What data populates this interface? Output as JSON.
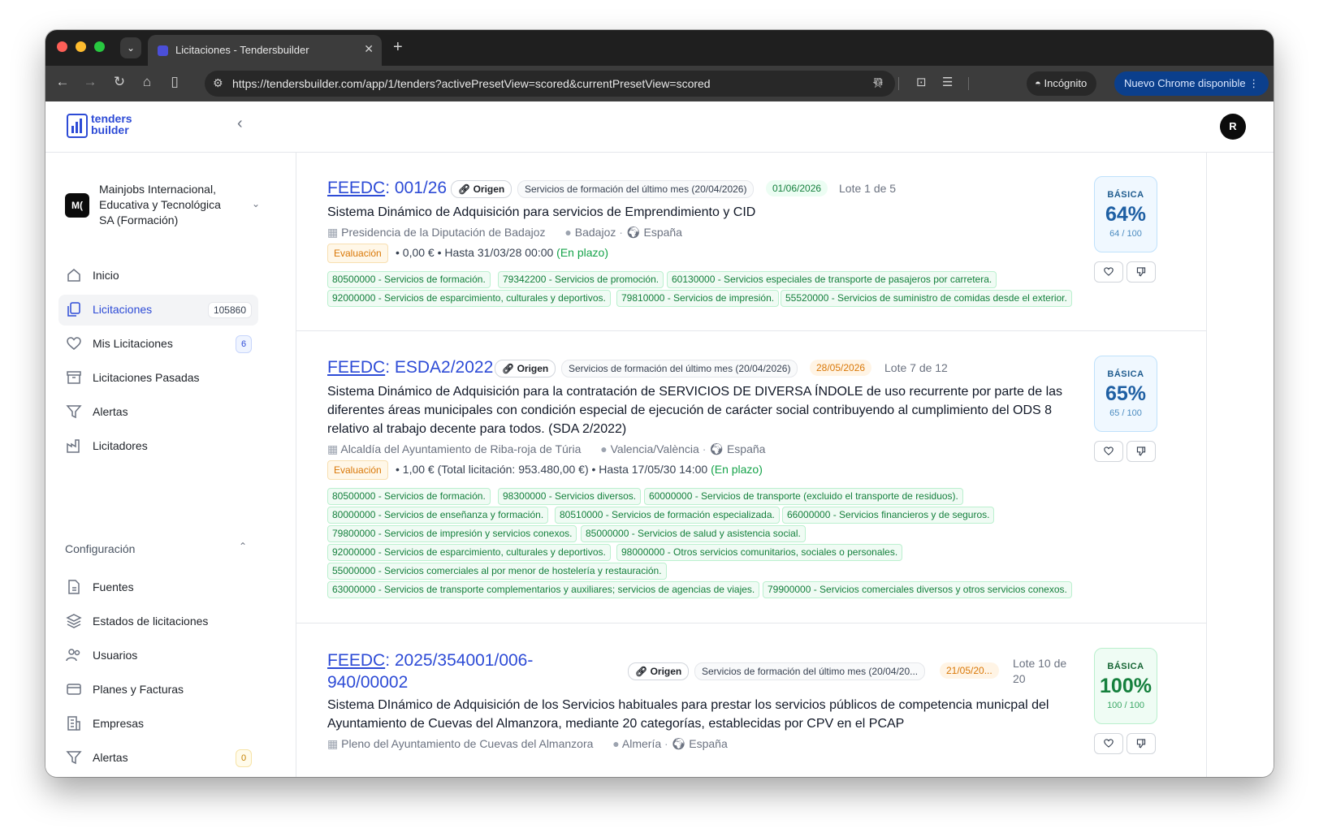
{
  "browser": {
    "tab_title": "Licitaciones - Tendersbuilder",
    "url": "https://tendersbuilder.com/app/1/tenders?activePresetView=scored&currentPresetView=scored",
    "incognito_label": "Incógnito",
    "update_label": "Nuevo Chrome disponible"
  },
  "app": {
    "logo_line1": "tenders",
    "logo_line2": "builder",
    "avatar_initial": "R"
  },
  "org": {
    "initials": "M(",
    "name": "Mainjobs Internacional, Educativa y Tecnológica SA (Formación)"
  },
  "nav": {
    "items": [
      {
        "label": "Inicio"
      },
      {
        "label": "Licitaciones",
        "count": "105860"
      },
      {
        "label": "Mis Licitaciones",
        "badge": "6"
      },
      {
        "label": "Licitaciones Pasadas"
      },
      {
        "label": "Alertas"
      },
      {
        "label": "Licitadores"
      }
    ],
    "config_title": "Configuración",
    "config_items": [
      {
        "label": "Fuentes"
      },
      {
        "label": "Estados de licitaciones"
      },
      {
        "label": "Usuarios"
      },
      {
        "label": "Planes y Facturas"
      },
      {
        "label": "Empresas"
      },
      {
        "label": "Alertas",
        "badge": "0"
      }
    ]
  },
  "tenders": [
    {
      "source": "FEEDC",
      "code": ": 001/26",
      "origin": "Origen",
      "source_chip": "Servicios de formación del último mes (20/04/2026)",
      "date": "01/06/2026",
      "lote": "Lote 1 de 5",
      "title": "Sistema Dinámico de Adquisición para servicios de Emprendimiento y CID",
      "organism": "Presidencia de la Diputación de Badajoz",
      "location": "Badajoz",
      "country": "España",
      "status": "Evaluación",
      "price": "• 0,00 € • Hasta 31/03/28 00:00",
      "deadline_state": "(En plazo)",
      "cpvs": [
        "80500000 - Servicios de formación.",
        "79342200 - Servicios de promoción.",
        "60130000 - Servicios especiales de transporte de pasajeros por carretera.",
        "92000000 - Servicios de esparcimiento, culturales y deportivos.",
        "79810000 - Servicios de impresión.",
        "55520000 - Servicios de suministro de comidas desde el exterior."
      ],
      "score_label": "BÁSICA",
      "score": "64%",
      "score_sub": "64 / 100"
    },
    {
      "source": "FEEDC",
      "code": ": ESDA2/2022",
      "origin": "Origen",
      "source_chip": "Servicios de formación del último mes (20/04/2026)",
      "date": "28/05/2026",
      "lote": "Lote 7 de 12",
      "title": "Sistema Dinámico de Adquisición para la contratación de SERVICIOS DE DIVERSA ÍNDOLE de uso recurrente por parte de las diferentes áreas municipales con condición especial de ejecución de carácter social contribuyendo al cumplimiento del ODS 8 relativo al trabajo decente para todos. (SDA 2/2022)",
      "organism": "Alcaldía del Ayuntamiento de Riba-roja de Túria",
      "location": "Valencia/València",
      "country": "España",
      "status": "Evaluación",
      "price": "• 1,00 €  (Total licitación: 953.480,00 €)  • Hasta 17/05/30 14:00",
      "deadline_state": "(En plazo)",
      "cpvs": [
        "80500000 - Servicios de formación.",
        "98300000 - Servicios diversos.",
        "60000000 - Servicios de transporte (excluido el transporte de residuos).",
        "80000000 - Servicios de enseñanza y formación.",
        "80510000 - Servicios de formación especializada.",
        "66000000 - Servicios financieros y de seguros.",
        "79800000 - Servicios de impresión y servicios conexos.",
        "85000000 - Servicios de salud y asistencia social.",
        "92000000 - Servicios de esparcimiento, culturales y deportivos.",
        "98000000 - Otros servicios comunitarios, sociales o personales.",
        "55000000 - Servicios comerciales al por menor de hostelería y restauración.",
        "63000000 - Servicios de transporte complementarios y auxiliares; servicios de agencias de viajes.",
        "79900000 - Servicios comerciales diversos y otros servicios conexos."
      ],
      "score_label": "BÁSICA",
      "score": "65%",
      "score_sub": "65 / 100"
    },
    {
      "source": "FEEDC",
      "code_line1": ": 2025/354001/006-",
      "code_line2": "940/00002",
      "origin": "Origen",
      "source_chip": "Servicios de formación del último mes (20/04/20...",
      "date": "21/05/20...",
      "lote_line1": "Lote 10 de",
      "lote_line2": "20",
      "title": "Sistema DInámico de Adquisición de los Servicios habituales para prestar los servicios públicos de competencia municpal del Ayuntamiento de Cuevas del Almanzora, mediante 20 categorías, establecidas por CPV en el PCAP",
      "organism": "Pleno del Ayuntamiento de Cuevas del Almanzora",
      "location": "Almería",
      "country": "España",
      "score_label": "BÁSICA",
      "score": "100%",
      "score_sub": "100 / 100"
    }
  ]
}
